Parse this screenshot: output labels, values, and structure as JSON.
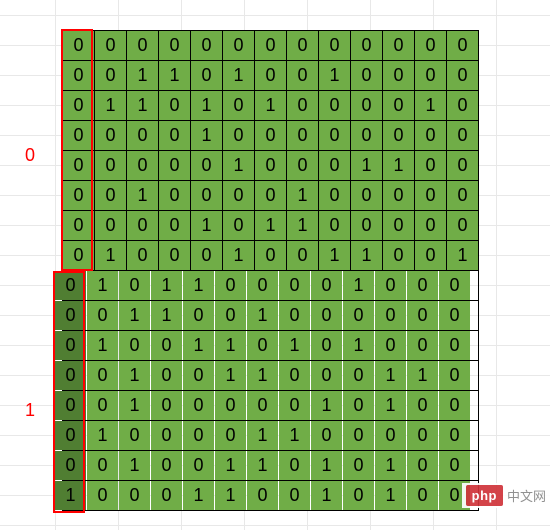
{
  "labels": {
    "group_0": "0",
    "group_1": "1"
  },
  "grid": {
    "shift_row": 8,
    "rows": [
      [
        0,
        0,
        0,
        0,
        0,
        0,
        0,
        0,
        0,
        0,
        0,
        0,
        0
      ],
      [
        0,
        0,
        1,
        1,
        0,
        1,
        0,
        0,
        1,
        0,
        0,
        0,
        0
      ],
      [
        0,
        1,
        1,
        0,
        1,
        0,
        1,
        0,
        0,
        0,
        0,
        1,
        0
      ],
      [
        0,
        0,
        0,
        0,
        1,
        0,
        0,
        0,
        0,
        0,
        0,
        0,
        0
      ],
      [
        0,
        0,
        0,
        0,
        0,
        1,
        0,
        0,
        0,
        1,
        1,
        0,
        0
      ],
      [
        0,
        0,
        1,
        0,
        0,
        0,
        0,
        1,
        0,
        0,
        0,
        0,
        0
      ],
      [
        0,
        0,
        0,
        0,
        1,
        0,
        1,
        1,
        0,
        0,
        0,
        0,
        0
      ],
      [
        0,
        1,
        0,
        0,
        0,
        1,
        0,
        0,
        1,
        1,
        0,
        0,
        1
      ],
      [
        0,
        1,
        0,
        1,
        1,
        0,
        0,
        0,
        0,
        1,
        0,
        0,
        0
      ],
      [
        0,
        0,
        1,
        1,
        0,
        0,
        1,
        0,
        0,
        0,
        0,
        0,
        0
      ],
      [
        0,
        1,
        0,
        0,
        1,
        1,
        0,
        1,
        0,
        1,
        0,
        0,
        0
      ],
      [
        0,
        0,
        1,
        0,
        0,
        1,
        1,
        0,
        0,
        0,
        1,
        1,
        0
      ],
      [
        0,
        0,
        1,
        0,
        0,
        0,
        0,
        0,
        1,
        0,
        1,
        0,
        0
      ],
      [
        0,
        1,
        0,
        0,
        0,
        0,
        1,
        1,
        0,
        0,
        0,
        0,
        0
      ],
      [
        0,
        0,
        1,
        0,
        0,
        1,
        1,
        0,
        1,
        0,
        1,
        0,
        0
      ],
      [
        1,
        0,
        0,
        0,
        1,
        1,
        0,
        0,
        1,
        0,
        1,
        0,
        0
      ]
    ]
  },
  "watermark": {
    "brand": "php",
    "suffix": "中文网"
  },
  "chart_data": {
    "type": "table",
    "title": "",
    "groups": [
      {
        "label": "0",
        "row_range": [
          0,
          7
        ],
        "first_column_highlight": "red-box"
      },
      {
        "label": "1",
        "row_range": [
          8,
          15
        ],
        "first_column_highlight": "red-box-shifted"
      }
    ],
    "values": [
      [
        0,
        0,
        0,
        0,
        0,
        0,
        0,
        0,
        0,
        0,
        0,
        0,
        0
      ],
      [
        0,
        0,
        1,
        1,
        0,
        1,
        0,
        0,
        1,
        0,
        0,
        0,
        0
      ],
      [
        0,
        1,
        1,
        0,
        1,
        0,
        1,
        0,
        0,
        0,
        0,
        1,
        0
      ],
      [
        0,
        0,
        0,
        0,
        1,
        0,
        0,
        0,
        0,
        0,
        0,
        0,
        0
      ],
      [
        0,
        0,
        0,
        0,
        0,
        1,
        0,
        0,
        0,
        1,
        1,
        0,
        0
      ],
      [
        0,
        0,
        1,
        0,
        0,
        0,
        0,
        1,
        0,
        0,
        0,
        0,
        0
      ],
      [
        0,
        0,
        0,
        0,
        1,
        0,
        1,
        1,
        0,
        0,
        0,
        0,
        0
      ],
      [
        0,
        1,
        0,
        0,
        0,
        1,
        0,
        0,
        1,
        1,
        0,
        0,
        1
      ],
      [
        0,
        1,
        0,
        1,
        1,
        0,
        0,
        0,
        0,
        1,
        0,
        0,
        0
      ],
      [
        0,
        0,
        1,
        1,
        0,
        0,
        1,
        0,
        0,
        0,
        0,
        0,
        0
      ],
      [
        0,
        1,
        0,
        0,
        1,
        1,
        0,
        1,
        0,
        1,
        0,
        0,
        0
      ],
      [
        0,
        0,
        1,
        0,
        0,
        1,
        1,
        0,
        0,
        0,
        1,
        1,
        0
      ],
      [
        0,
        0,
        1,
        0,
        0,
        0,
        0,
        0,
        1,
        0,
        1,
        0,
        0
      ],
      [
        0,
        1,
        0,
        0,
        0,
        0,
        1,
        1,
        0,
        0,
        0,
        0,
        0
      ],
      [
        0,
        0,
        1,
        0,
        0,
        1,
        1,
        0,
        1,
        0,
        1,
        0,
        0
      ],
      [
        1,
        0,
        0,
        0,
        1,
        1,
        0,
        0,
        1,
        0,
        1,
        0,
        0
      ]
    ],
    "cell_fill": "#70AD47",
    "highlighted_first_column_fill_rows_8_to_15": "#507E32",
    "box_color": "#ff0000"
  }
}
